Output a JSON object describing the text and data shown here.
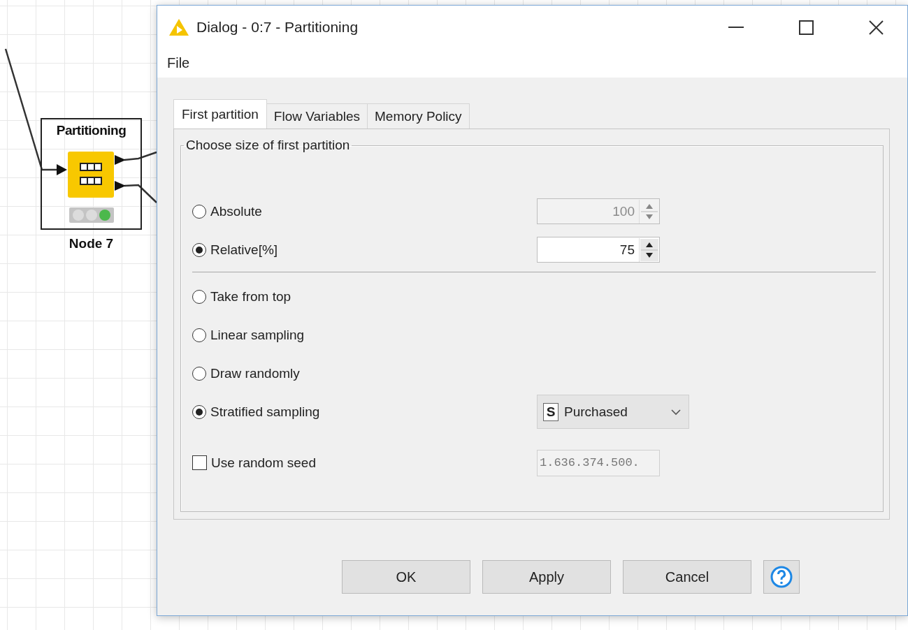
{
  "canvas": {
    "node": {
      "title": "Partitioning",
      "label": "Node 7",
      "status_lights": [
        {
          "color": "#dcdcdc"
        },
        {
          "color": "#dcdcdc"
        },
        {
          "color": "#4cb84c"
        }
      ]
    }
  },
  "dialog": {
    "title": "Dialog - 0:7 - Partitioning",
    "menu": [
      "File"
    ],
    "tabs": [
      {
        "label": "First partition",
        "selected": true
      },
      {
        "label": "Flow Variables",
        "selected": false
      },
      {
        "label": "Memory Policy",
        "selected": false
      }
    ],
    "group_title": "Choose size of first partition",
    "size_options": [
      {
        "label": "Absolute",
        "selected": false,
        "control": {
          "kind": "spinner",
          "value": "100",
          "disabled": true
        }
      },
      {
        "label": "Relative[%]",
        "selected": true,
        "control": {
          "kind": "spinner",
          "value": "75",
          "disabled": false
        }
      }
    ],
    "sampling_options": [
      {
        "label": "Take from top",
        "selected": false
      },
      {
        "label": "Linear sampling",
        "selected": false
      },
      {
        "label": "Draw randomly",
        "selected": false
      },
      {
        "label": "Stratified sampling",
        "selected": true,
        "control": {
          "kind": "dropdown",
          "badge": "S",
          "value": "Purchased"
        }
      }
    ],
    "seed": {
      "label": "Use random seed",
      "checked": false,
      "value": "1.636.374.500."
    },
    "buttons": [
      "OK",
      "Apply",
      "Cancel"
    ]
  }
}
